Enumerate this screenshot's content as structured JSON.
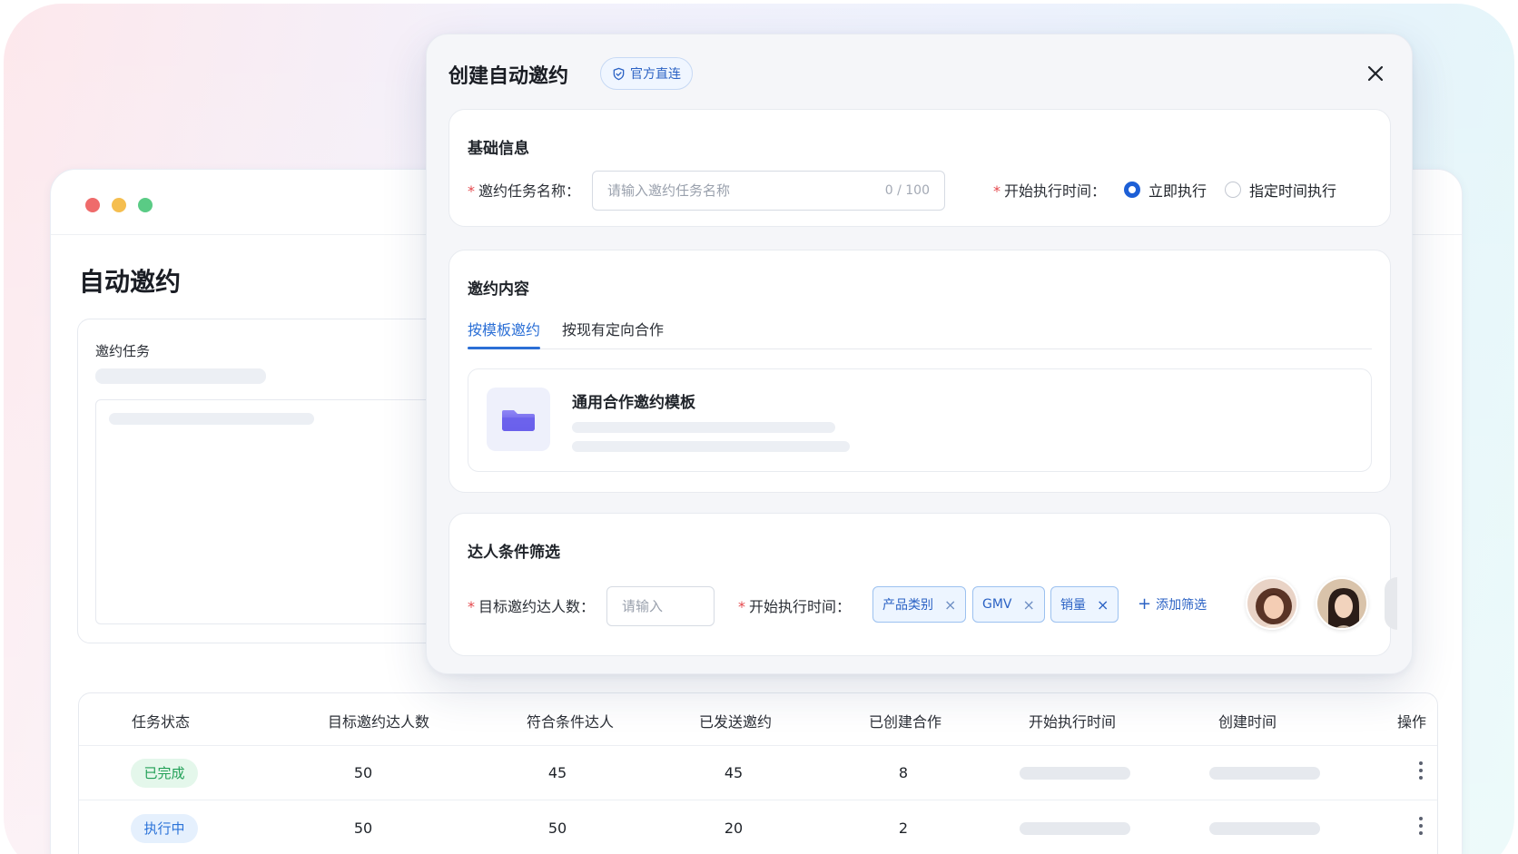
{
  "app": {
    "page_title": "自动邀约",
    "task_card_title": "邀约任务"
  },
  "table": {
    "headers": [
      "任务状态",
      "目标邀约达人数",
      "符合条件达人",
      "已发送邀约",
      "已创建合作",
      "开始执行时间",
      "创建时间",
      "操作"
    ],
    "rows": [
      {
        "status": "已完成",
        "target": "50",
        "eligible": "45",
        "sent": "45",
        "created": "8"
      },
      {
        "status": "执行中",
        "target": "50",
        "eligible": "50",
        "sent": "20",
        "created": "2"
      }
    ]
  },
  "modal": {
    "title": "创建自动邀约",
    "badge": "官方直连",
    "basic": {
      "title": "基础信息",
      "name_label": "邀约任务名称：",
      "name_placeholder": "请输入邀约任务名称",
      "name_counter": "0 / 100",
      "start_label": "开始执行时间：",
      "options": [
        "立即执行",
        "指定时间执行"
      ],
      "selected": "立即执行"
    },
    "content": {
      "title": "邀约内容",
      "tabs": [
        "按模板邀约",
        "按现有定向合作"
      ],
      "active_tab": "按模板邀约",
      "template_name": "通用合作邀约模板"
    },
    "filter": {
      "title": "达人条件筛选",
      "target_label": "目标邀约达人数：",
      "target_placeholder": "请输入",
      "start_label": "开始执行时间：",
      "tags": [
        "产品类别",
        "GMV",
        "销量"
      ],
      "add_label": "添加筛选"
    }
  },
  "colors": {
    "primary": "#2b6fd6",
    "required": "#e5484d",
    "success": "#1f9f55"
  }
}
